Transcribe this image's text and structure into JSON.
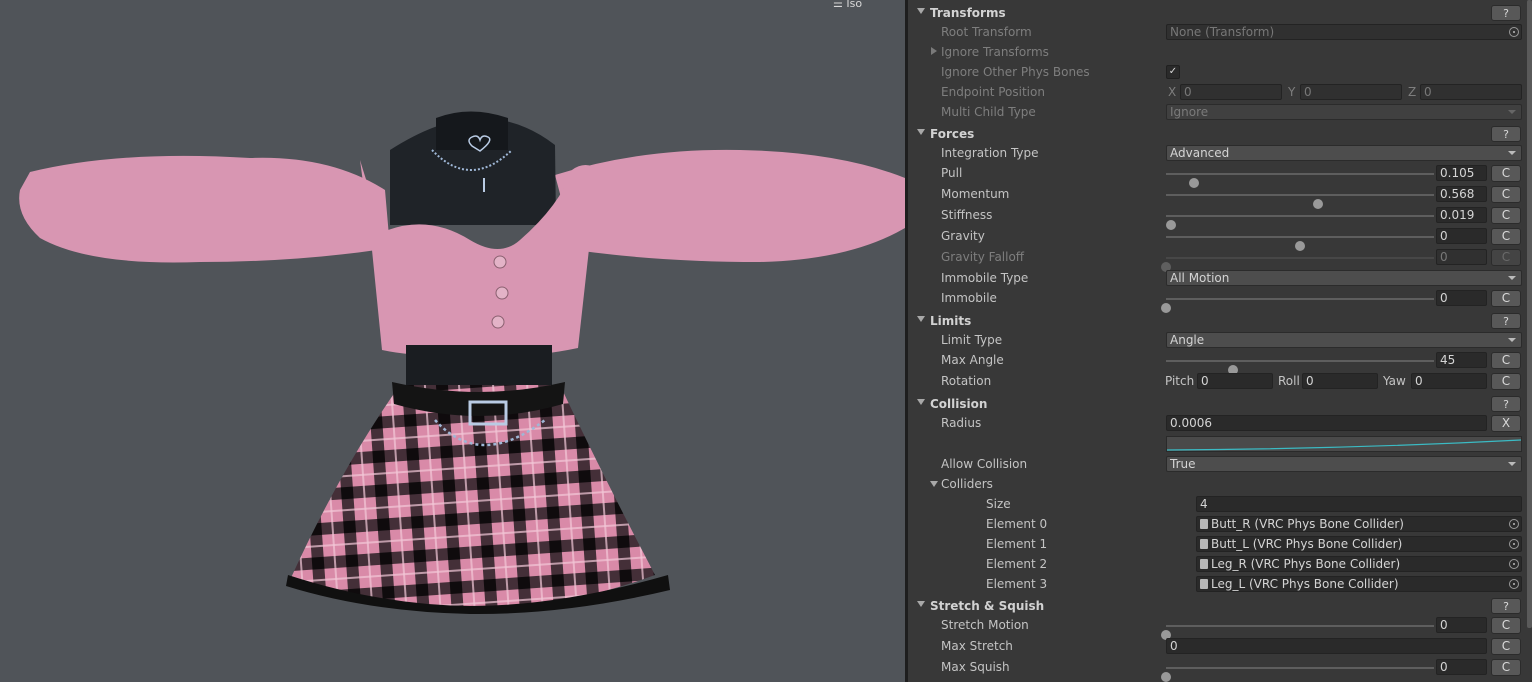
{
  "viewport": {
    "iso_label": "Iso"
  },
  "inspector": {
    "transforms": {
      "title": "Transforms",
      "help": "?",
      "root_transform_label": "Root Transform",
      "root_transform_value": "None (Transform)",
      "ignore_transforms_label": "Ignore Transforms",
      "ignore_other_label": "Ignore Other Phys Bones",
      "ignore_other_checked": "✓",
      "endpoint_label": "Endpoint Position",
      "x_label": "X",
      "x_value": "0",
      "y_label": "Y",
      "y_value": "0",
      "z_label": "Z",
      "z_value": "0",
      "multi_child_label": "Multi Child Type",
      "multi_child_value": "Ignore"
    },
    "forces": {
      "title": "Forces",
      "help": "?",
      "integration_label": "Integration Type",
      "integration_value": "Advanced",
      "pull_label": "Pull",
      "pull_value": "0.105",
      "momentum_label": "Momentum",
      "momentum_value": "0.568",
      "stiffness_label": "Stiffness",
      "stiffness_value": "0.019",
      "gravity_label": "Gravity",
      "gravity_value": "0",
      "gravity_slider": 0.5,
      "gravity_falloff_label": "Gravity Falloff",
      "gravity_falloff_value": "0",
      "immobile_type_label": "Immobile Type",
      "immobile_type_value": "All Motion",
      "immobile_label": "Immobile",
      "immobile_value": "0",
      "c": "C"
    },
    "limits": {
      "title": "Limits",
      "help": "?",
      "limit_type_label": "Limit Type",
      "limit_type_value": "Angle",
      "max_angle_label": "Max Angle",
      "max_angle_value": "45",
      "max_angle_max": 180,
      "rotation_label": "Rotation",
      "pitch_label": "Pitch",
      "pitch_value": "0",
      "roll_label": "Roll",
      "roll_value": "0",
      "yaw_label": "Yaw",
      "yaw_value": "0"
    },
    "collision": {
      "title": "Collision",
      "help": "?",
      "radius_label": "Radius",
      "radius_value": "0.0006",
      "x_button": "X",
      "allow_label": "Allow Collision",
      "allow_value": "True",
      "colliders_label": "Colliders",
      "size_label": "Size",
      "size_value": "4",
      "elements": [
        {
          "label": "Element 0",
          "value": "Butt_R (VRC Phys Bone Collider)"
        },
        {
          "label": "Element 1",
          "value": "Butt_L (VRC Phys Bone Collider)"
        },
        {
          "label": "Element 2",
          "value": "Leg_R (VRC Phys Bone Collider)"
        },
        {
          "label": "Element 3",
          "value": "Leg_L (VRC Phys Bone Collider)"
        }
      ]
    },
    "stretch": {
      "title": "Stretch & Squish",
      "help": "?",
      "stretch_motion_label": "Stretch Motion",
      "stretch_motion_value": "0",
      "max_stretch_label": "Max Stretch",
      "max_stretch_value": "0",
      "max_squish_label": "Max Squish",
      "max_squish_value": "0"
    }
  }
}
